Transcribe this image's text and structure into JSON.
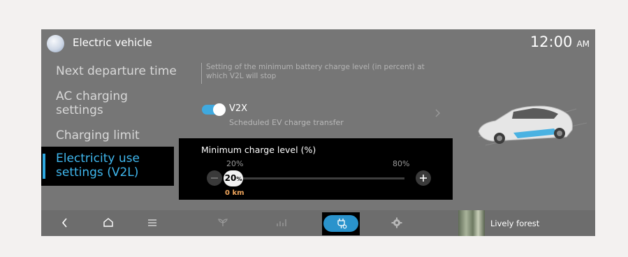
{
  "header": {
    "title": "Electric vehicle",
    "clock_time": "12:00",
    "clock_ampm": "AM"
  },
  "menu": {
    "items": [
      {
        "label": "Next departure time"
      },
      {
        "label_line1": "AC charging",
        "label_line2": "settings"
      },
      {
        "label": "Charging limit"
      }
    ],
    "active": {
      "label_line1": "Electricity use",
      "label_line2": "settings (V2L)"
    }
  },
  "description": {
    "line1": "Setting of the minimum battery charge level (in percent) at",
    "line2": "which V2L will stop"
  },
  "v2x": {
    "label": "V2X",
    "sublabel": "Scheduled EV charge transfer",
    "enabled": true
  },
  "popup": {
    "title": "Minimum charge level (%)",
    "min_label": "20%",
    "max_label": "80%",
    "value": "20",
    "value_unit": "%",
    "range_text": "0 km",
    "slider_fraction": 0
  },
  "bottom_bar": {
    "icons": [
      "back-icon",
      "home-icon",
      "menu-icon",
      "eco-leaf-icon",
      "energy-graph-icon",
      "charging-plug-icon",
      "settings-gear-icon"
    ],
    "media_title": "Lively forest"
  },
  "colors": {
    "accent": "#3fb7ee",
    "range": "#f0a65c",
    "screen_bg": "#767676"
  }
}
